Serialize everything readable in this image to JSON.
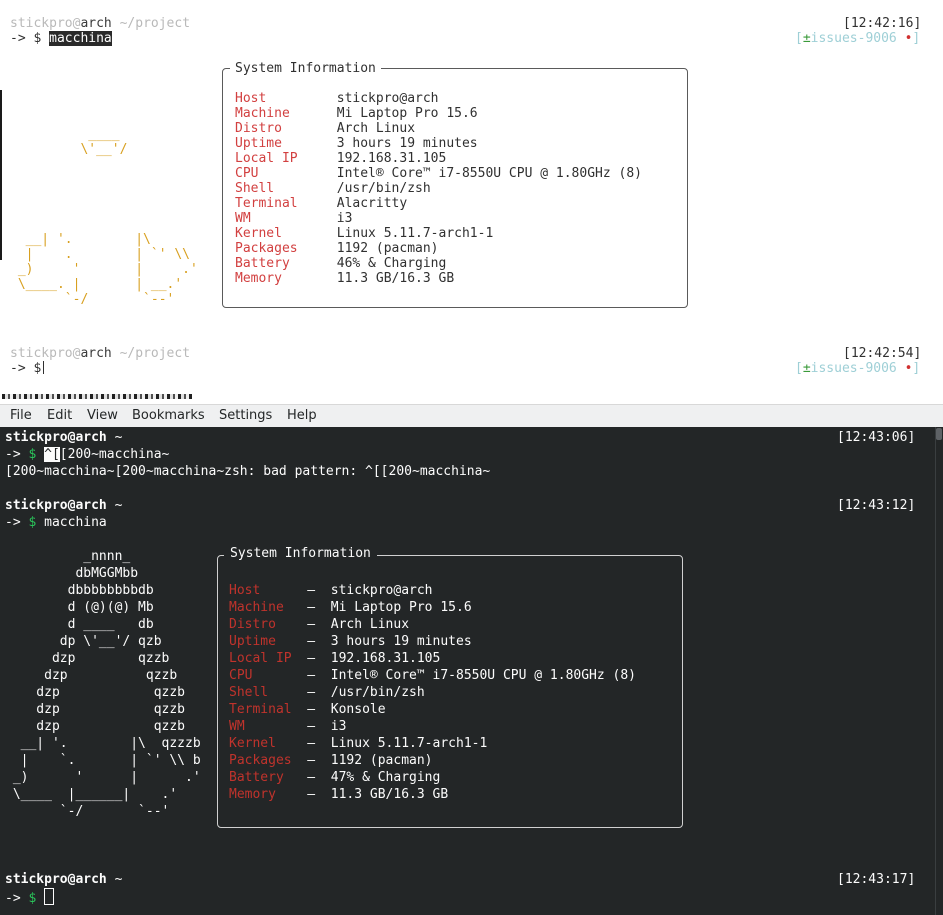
{
  "top_terminal": {
    "prompt1": {
      "user": "stickpro",
      "at": "@",
      "host": "arch",
      "path": "~/project",
      "arrow": "->",
      "dollar": "$",
      "command": "macchina",
      "time": "[12:42:16]",
      "branch_open": "[",
      "branch_plus": "±",
      "branch": "issues-9006",
      "branch_dot": "•",
      "branch_close": "]"
    },
    "box_title": "System Information",
    "rows": [
      {
        "label": "Host",
        "value": "stickpro@arch"
      },
      {
        "label": "Machine",
        "value": "Mi Laptop Pro 15.6"
      },
      {
        "label": "Distro",
        "value": "Arch Linux"
      },
      {
        "label": "Uptime",
        "value": "3 hours 19 minutes"
      },
      {
        "label": "Local IP",
        "value": "192.168.31.105"
      },
      {
        "label": "CPU",
        "value": "Intel® Core™ i7-8550U CPU @ 1.80GHz (8)"
      },
      {
        "label": "Shell",
        "value": "/usr/bin/zsh"
      },
      {
        "label": "Terminal",
        "value": "Alacritty"
      },
      {
        "label": "WM",
        "value": "i3"
      },
      {
        "label": "Kernel",
        "value": "Linux 5.11.7-arch1-1"
      },
      {
        "label": "Packages",
        "value": "1192 (pacman)"
      },
      {
        "label": "Battery",
        "value": "46% & Charging"
      },
      {
        "label": "Memory",
        "value": "11.3 GB/16.3 GB"
      }
    ],
    "art": [
      "          ____",
      "         \\'__'/",
      "",
      "",
      "",
      "",
      "",
      "  __| '.        |\\",
      "  |    .        | `' \\\\",
      " _)     '       |     .'",
      " \\____. |       | __.'",
      "       `-/       `--'"
    ],
    "prompt2": {
      "user": "stickpro",
      "at": "@",
      "host": "arch",
      "path": "~/project",
      "arrow": "->",
      "dollar": "$",
      "time": "[12:42:54]",
      "branch_open": "[",
      "branch_plus": "±",
      "branch": "issues-9006",
      "branch_dot": "•",
      "branch_close": "]"
    }
  },
  "menubar": {
    "file": "File",
    "edit": "Edit",
    "view": "View",
    "bookmarks": "Bookmarks",
    "settings": "Settings",
    "help": "Help"
  },
  "konsole": {
    "prompt1": {
      "userhost": "stickpro@arch",
      "path": "~",
      "time": "[12:43:06]",
      "arrow": "->",
      "dollar": "$",
      "cmd_hl": "^[",
      "cmd_rest": "[200~macchina~"
    },
    "error_line": "[200~macchina~[200~macchina~zsh: bad pattern: ^[[200~macchina~",
    "prompt2": {
      "userhost": "stickpro@arch",
      "path": "~",
      "time": "[12:43:12]",
      "arrow": "->",
      "dollar": "$",
      "command": "macchina"
    },
    "box_title": "System Information",
    "separator": "—",
    "rows": [
      {
        "label": "Host",
        "value": "stickpro@arch"
      },
      {
        "label": "Machine",
        "value": "Mi Laptop Pro 15.6"
      },
      {
        "label": "Distro",
        "value": "Arch Linux"
      },
      {
        "label": "Uptime",
        "value": "3 hours 19 minutes"
      },
      {
        "label": "Local IP",
        "value": "192.168.31.105"
      },
      {
        "label": "CPU",
        "value": "Intel® Core™ i7-8550U CPU @ 1.80GHz (8)"
      },
      {
        "label": "Shell",
        "value": "/usr/bin/zsh"
      },
      {
        "label": "Terminal",
        "value": "Konsole"
      },
      {
        "label": "WM",
        "value": "i3"
      },
      {
        "label": "Kernel",
        "value": "Linux 5.11.7-arch1-1"
      },
      {
        "label": "Packages",
        "value": "1192 (pacman)"
      },
      {
        "label": "Battery",
        "value": "47% & Charging"
      },
      {
        "label": "Memory",
        "value": "11.3 GB/16.3 GB"
      }
    ],
    "art_white": [
      "          _nnnn_",
      "         dbMGGMbb",
      "        dbbbbbbbbdb",
      "        d (@)(@) Mb",
      "        d        db",
      "       dp        qzb",
      "      dzp        qzzb",
      "     dzp          qzzb",
      "    dzp            qzzb",
      "    dzp            qzzb",
      "    dzp            qzzb",
      "                    qzzzb",
      "                        b",
      "",
      "",
      ""
    ],
    "art_yellow": [
      "",
      "",
      "",
      "",
      "          ____",
      "          \\'__'/",
      "",
      "",
      "",
      "",
      "",
      "  __| '.        |\\",
      "  |    `.       | `' \\\\",
      " _)      '      |      .'",
      " \\____  |______|    .'",
      "       `-/       `--'"
    ],
    "prompt3": {
      "userhost": "stickpro@arch",
      "path": "~",
      "time": "[12:43:17]",
      "arrow": "->",
      "dollar": "$"
    }
  }
}
